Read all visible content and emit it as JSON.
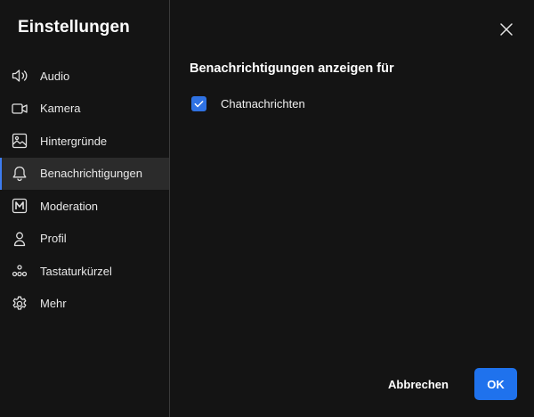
{
  "dialog": {
    "title": "Einstellungen"
  },
  "sidebar": {
    "items": [
      {
        "label": "Audio",
        "icon": "speaker-icon",
        "active": false
      },
      {
        "label": "Kamera",
        "icon": "camera-icon",
        "active": false
      },
      {
        "label": "Hintergründe",
        "icon": "image-icon",
        "active": false
      },
      {
        "label": "Benachrichtigungen",
        "icon": "bell-icon",
        "active": true
      },
      {
        "label": "Moderation",
        "icon": "moderation-icon",
        "active": false
      },
      {
        "label": "Profil",
        "icon": "person-icon",
        "active": false
      },
      {
        "label": "Tastaturkürzel",
        "icon": "shortcuts-icon",
        "active": false
      },
      {
        "label": "Mehr",
        "icon": "gear-icon",
        "active": false
      }
    ]
  },
  "main": {
    "section_title": "Benachrichtigungen anzeigen für",
    "options": [
      {
        "label": "Chatnachrichten",
        "checked": true
      }
    ]
  },
  "footer": {
    "cancel_label": "Abbrechen",
    "ok_label": "OK"
  },
  "colors": {
    "background": "#141414",
    "active_item_bg": "#2b2b2b",
    "accent": "#1f72ed",
    "text": "#ffffff"
  }
}
